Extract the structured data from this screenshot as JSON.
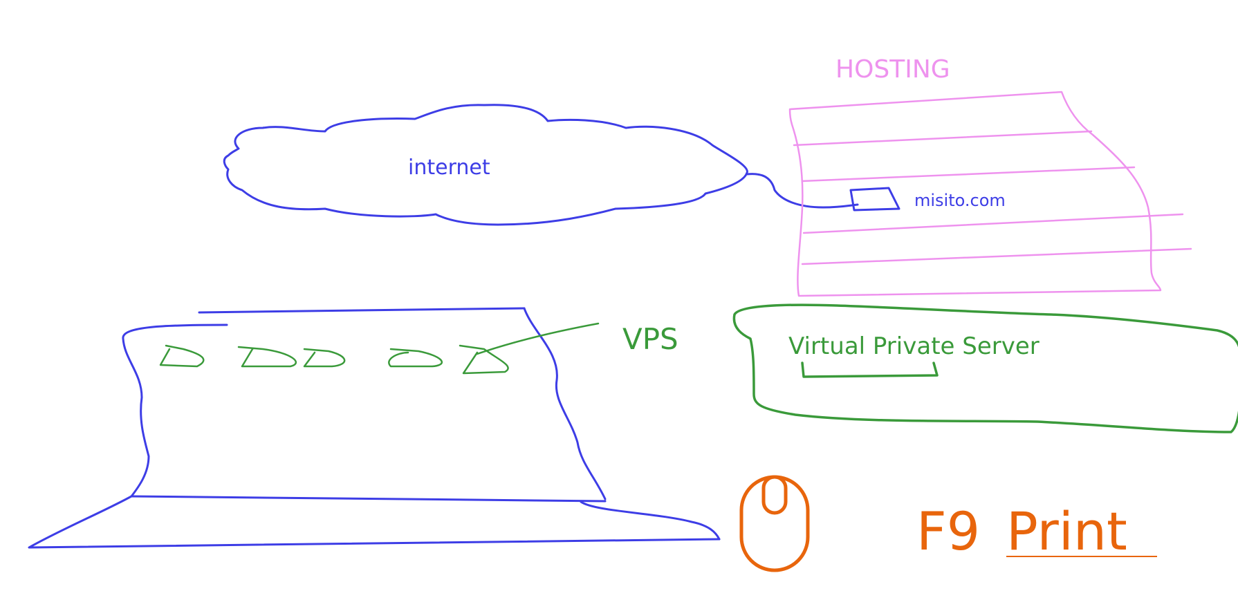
{
  "diagram": {
    "labels": {
      "internet": "internet",
      "hosting": "HOSTING",
      "site": "misito.com",
      "vps": "VPS",
      "vps_full": "Virtual Private Server"
    },
    "colors": {
      "blue": "#3d3de6",
      "pink": "#ee92ee",
      "green": "#3a9a3a",
      "orange": "#e8650c"
    }
  },
  "overlay": {
    "key": "F9",
    "action": "Print",
    "icon": "mouse-icon"
  }
}
